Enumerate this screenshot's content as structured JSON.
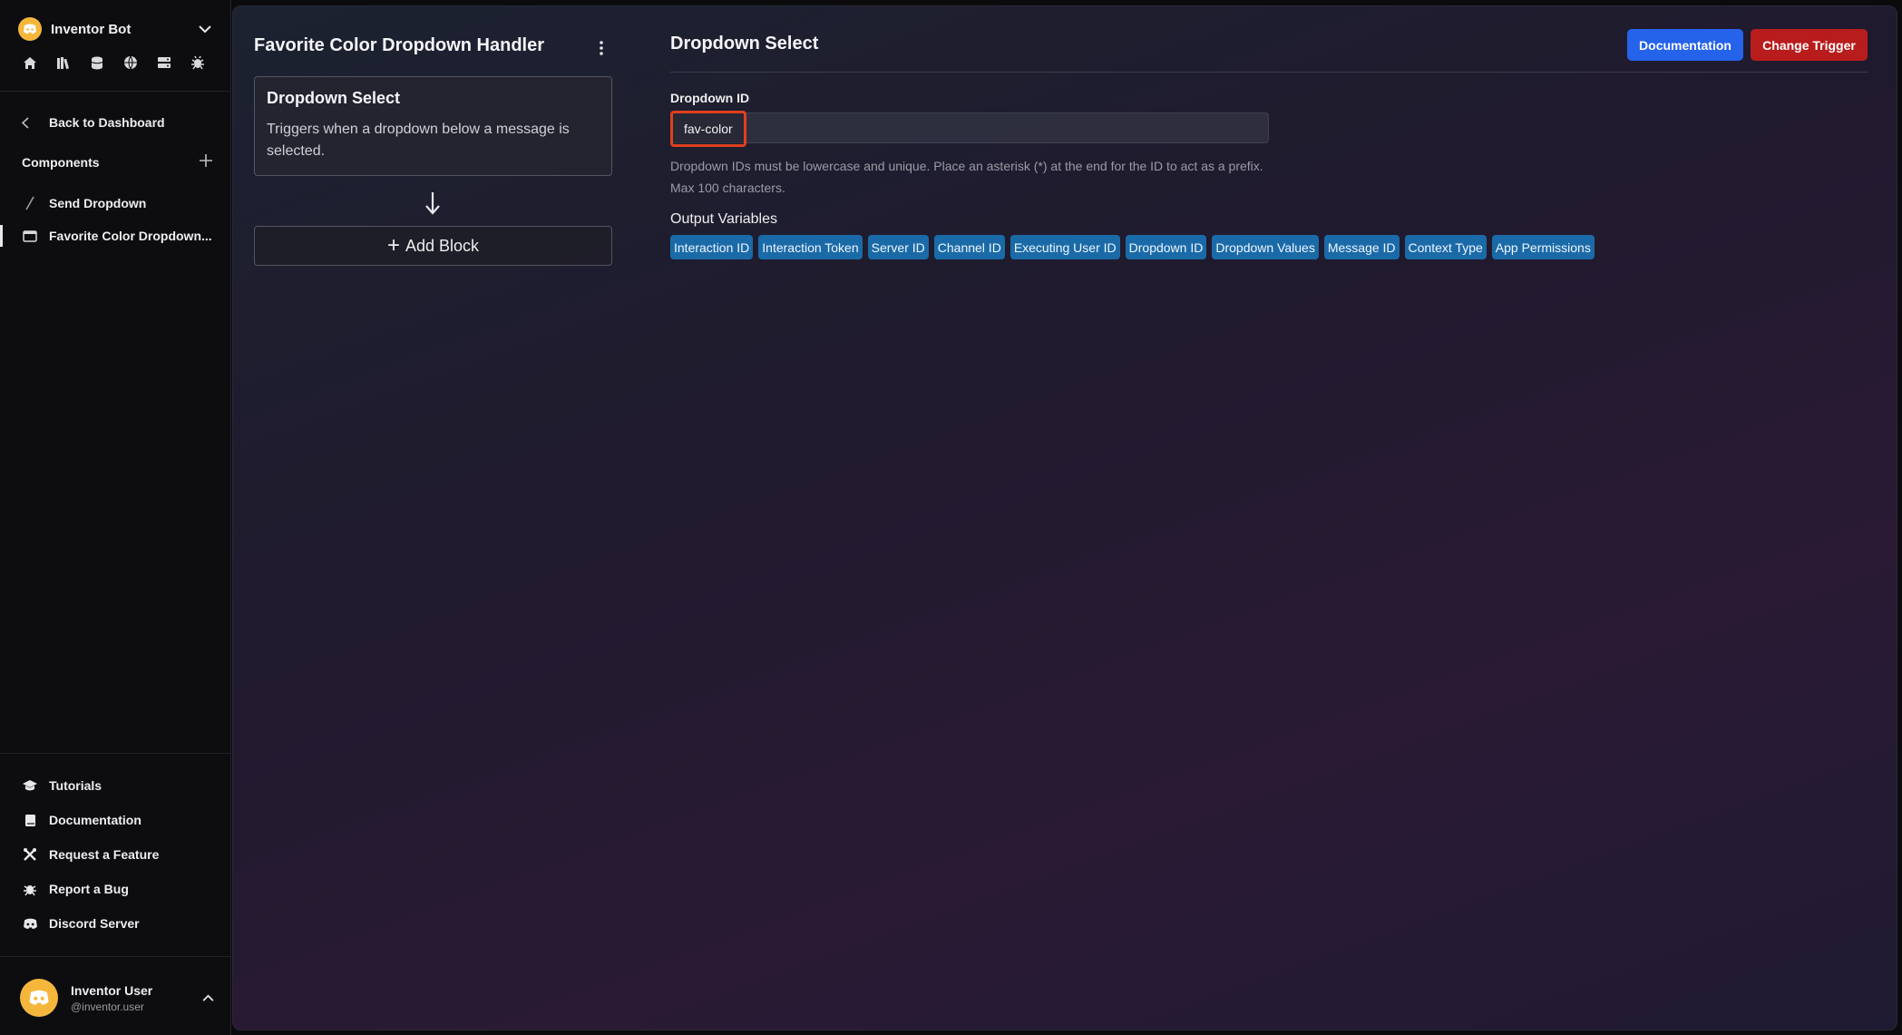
{
  "sidebar": {
    "bot_name": "Inventor Bot",
    "quick_icons": [
      "home-icon",
      "library-icon",
      "database-icon",
      "globe-icon",
      "server-icon",
      "bug-icon"
    ],
    "back_label": "Back to Dashboard",
    "components_label": "Components",
    "components": [
      {
        "label": "Send Dropdown",
        "icon": "slash-command-icon"
      },
      {
        "label": "Favorite Color Dropdown...",
        "icon": "message-component-icon"
      }
    ],
    "footer_links": [
      {
        "label": "Tutorials",
        "icon": "graduation-cap-icon"
      },
      {
        "label": "Documentation",
        "icon": "book-icon"
      },
      {
        "label": "Request a Feature",
        "icon": "tools-icon"
      },
      {
        "label": "Report a Bug",
        "icon": "bug-icon"
      },
      {
        "label": "Discord Server",
        "icon": "discord-icon"
      }
    ],
    "user": {
      "name": "Inventor User",
      "handle": "@inventor.user"
    }
  },
  "flow": {
    "title": "Favorite Color Dropdown Handler",
    "trigger_card": {
      "title": "Dropdown Select",
      "description": "Triggers when a dropdown below a message is selected."
    },
    "add_block_label": "Add Block"
  },
  "detail": {
    "title": "Dropdown Select",
    "documentation_button": "Documentation",
    "change_trigger_button": "Change Trigger",
    "field_label": "Dropdown ID",
    "field_value": "fav-color",
    "help_text": "Dropdown IDs must be lowercase and unique. Place an asterisk (*) at the end for the ID to act as a prefix. Max 100 characters.",
    "output_label": "Output Variables",
    "output_variables": [
      "Interaction ID",
      "Interaction Token",
      "Server ID",
      "Channel ID",
      "Executing User ID",
      "Dropdown ID",
      "Dropdown Values",
      "Message ID",
      "Context Type",
      "App Permissions"
    ]
  },
  "colors": {
    "accent_blue": "#2563eb",
    "danger_red": "#b91c1c",
    "chip_blue": "#1b6aa8",
    "highlight_orange": "#e0401e",
    "avatar_yellow": "#f5b73b"
  }
}
